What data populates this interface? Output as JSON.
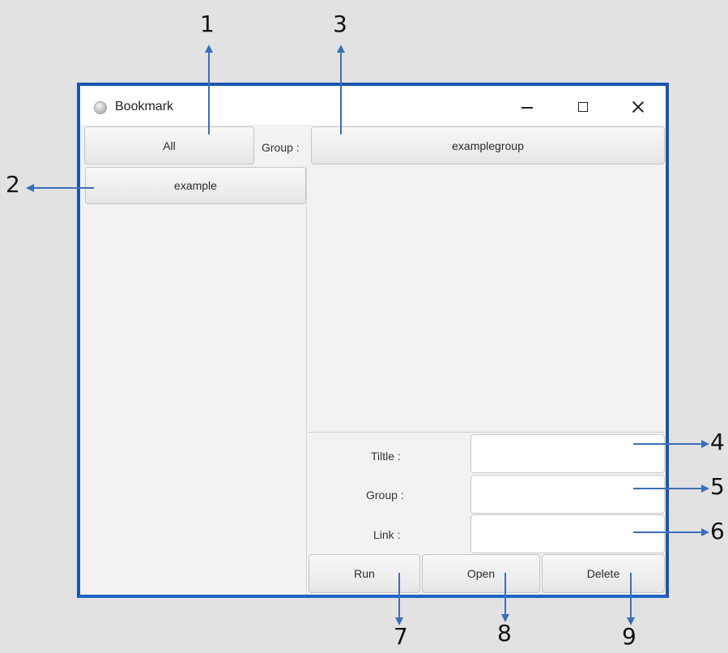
{
  "window": {
    "title": "Bookmark"
  },
  "toolbar": {
    "all_label": "All",
    "group_label": "Group :",
    "group_value": "examplegroup"
  },
  "groups": {
    "items": [
      {
        "label": "example"
      }
    ]
  },
  "form": {
    "title_label": "Tiltle :",
    "group_label": "Group :",
    "link_label": "Link :",
    "title_value": "",
    "group_value": "",
    "link_value": ""
  },
  "actions": {
    "run_label": "Run",
    "open_label": "Open",
    "delete_label": "Delete"
  },
  "annotations": [
    "1",
    "2",
    "3",
    "4",
    "5",
    "6",
    "7",
    "8",
    "9"
  ],
  "colors": {
    "window_border": "#1a55b0",
    "annotation_arrow": "#3c6fb4"
  }
}
